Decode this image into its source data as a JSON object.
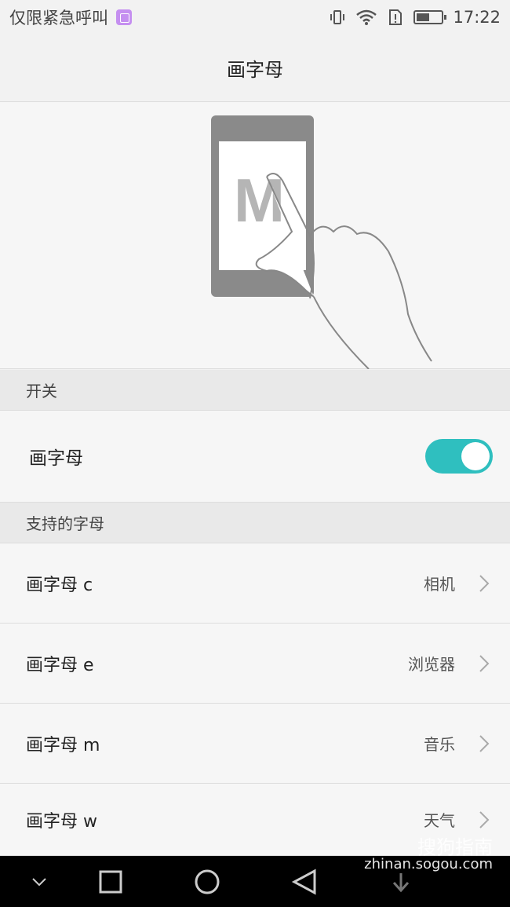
{
  "status_bar": {
    "carrier_text": "仅限紧急呼叫",
    "time": "17:22",
    "icons": [
      "vibrate-icon",
      "wifi-icon",
      "sim-alert-icon",
      "battery-icon"
    ]
  },
  "header": {
    "title": "画字母"
  },
  "illustration": {
    "letter": "M"
  },
  "sections": {
    "switch_header": "开关",
    "letters_header": "支持的字母"
  },
  "toggle": {
    "label": "画字母",
    "state": "on"
  },
  "items": [
    {
      "label": "画字母 c",
      "value": "相机"
    },
    {
      "label": "画字母 e",
      "value": "浏览器"
    },
    {
      "label": "画字母 m",
      "value": "音乐"
    },
    {
      "label": "画字母 w",
      "value": "天气"
    }
  ],
  "watermark": {
    "line1": "搜狗指南",
    "line2": "zhinan.sogou.com"
  },
  "colors": {
    "accent": "#2fbfbf",
    "nav_bg": "#000000"
  }
}
